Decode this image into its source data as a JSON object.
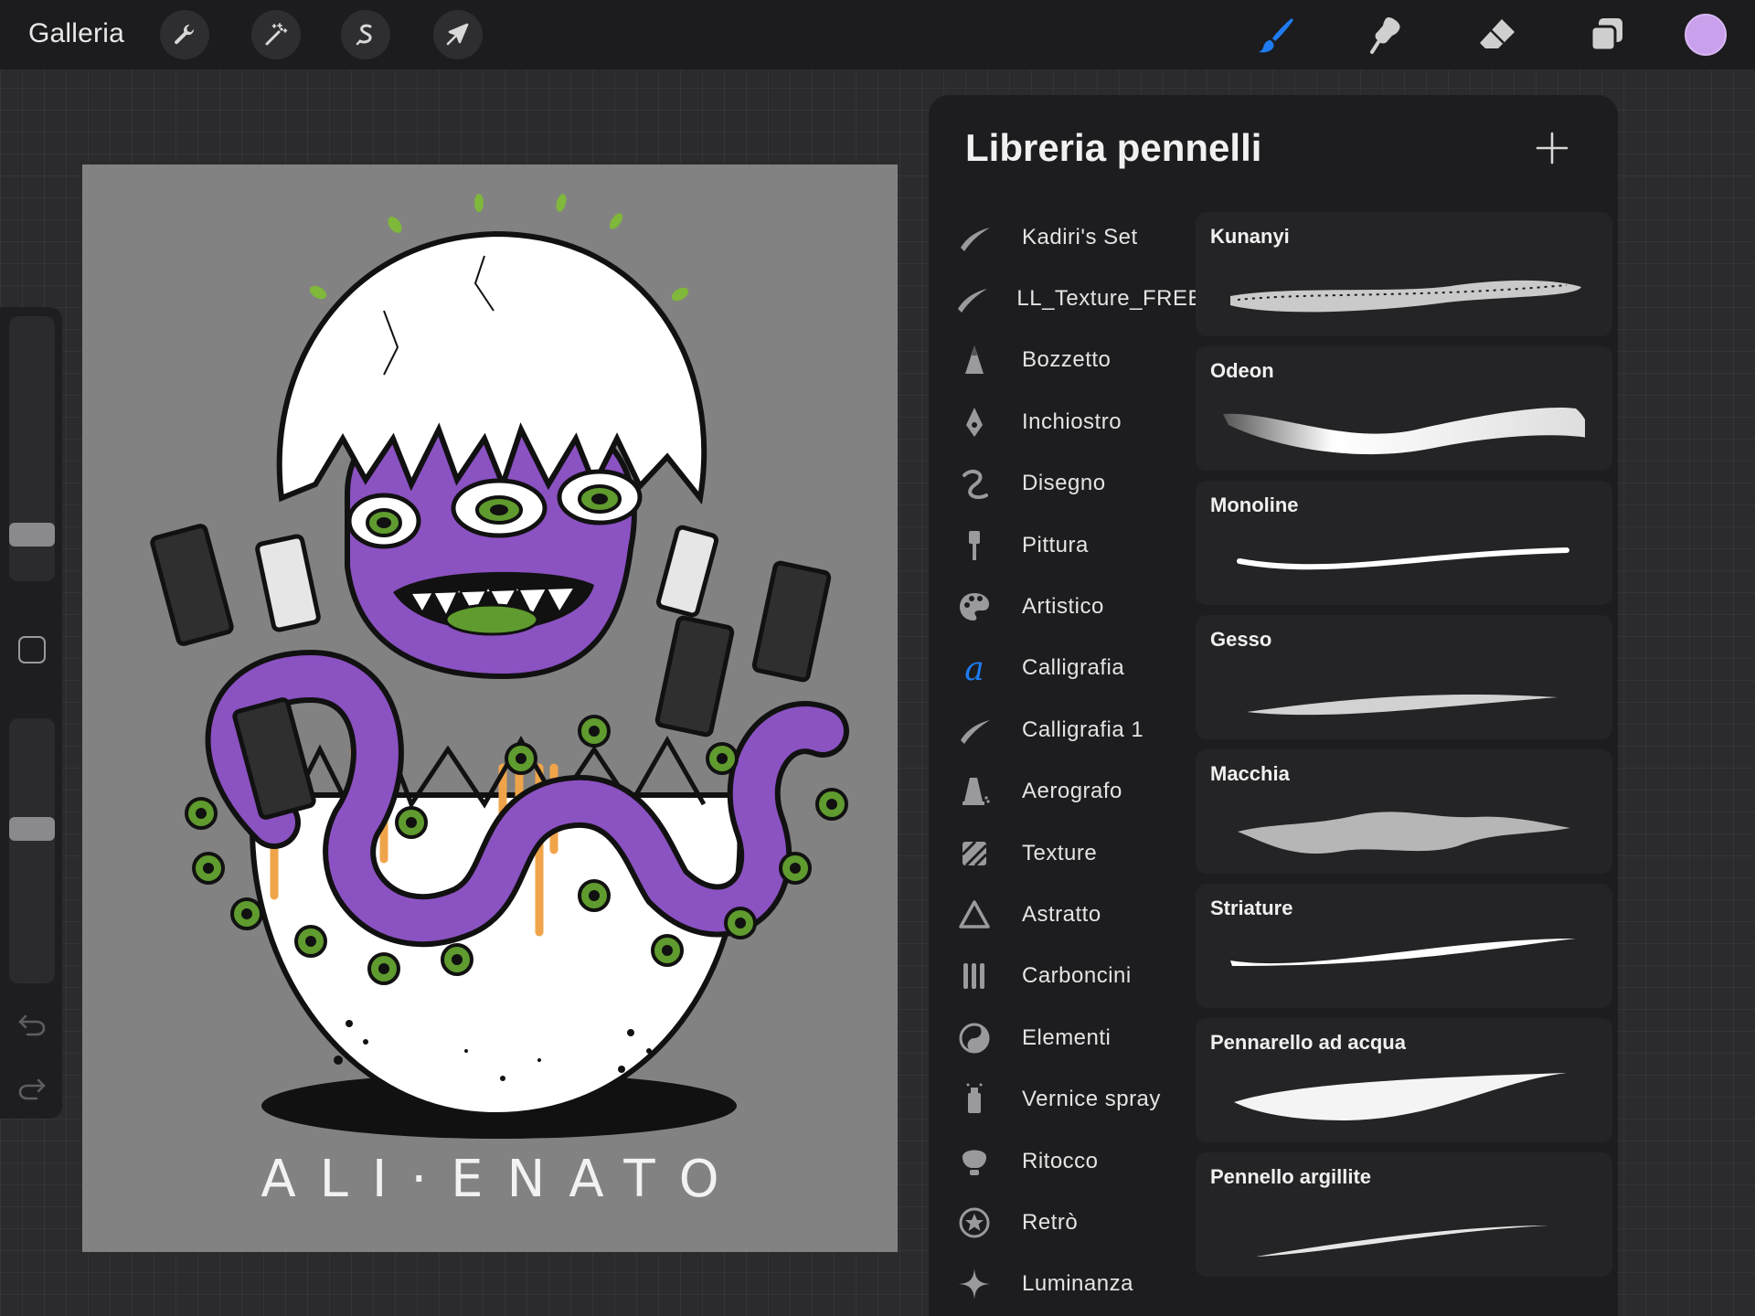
{
  "topbar": {
    "gallery_label": "Galleria",
    "left_tools": [
      {
        "name": "actions",
        "icon": "wrench-icon"
      },
      {
        "name": "adjustments",
        "icon": "magic-wand-icon"
      },
      {
        "name": "selection",
        "icon": "selection-s-icon"
      },
      {
        "name": "transform",
        "icon": "arrow-cursor-icon"
      }
    ],
    "right_tools": [
      {
        "name": "brush",
        "icon": "brush-icon",
        "active": true
      },
      {
        "name": "smudge",
        "icon": "smudge-icon"
      },
      {
        "name": "eraser",
        "icon": "eraser-icon"
      },
      {
        "name": "layers",
        "icon": "layers-icon"
      }
    ],
    "color": "#c9a0ec",
    "accent": "#1e7cf2"
  },
  "sidebar": {
    "size_slider_level": 0.25,
    "opacity_slider_level": 0.6
  },
  "artwork": {
    "caption": "ALIENATO",
    "background": "#828282",
    "colors": {
      "purple": "#8b52c2",
      "green": "#5f9b2e",
      "orange": "#f0a44a"
    }
  },
  "panel": {
    "title": "Libreria pennelli",
    "add_icon": "plus-icon",
    "sets": [
      {
        "label": "Kadiri's Set",
        "icon": "stroke-icon"
      },
      {
        "label": "LL_Texture_FREE",
        "icon": "stroke-icon"
      },
      {
        "label": "Bozzetto",
        "icon": "pencil-tip-icon"
      },
      {
        "label": "Inchiostro",
        "icon": "pen-nib-icon"
      },
      {
        "label": "Disegno",
        "icon": "squiggle-icon"
      },
      {
        "label": "Pittura",
        "icon": "paint-brush-icon"
      },
      {
        "label": "Artistico",
        "icon": "palette-icon"
      },
      {
        "label": "Calligrafia",
        "icon": "calligraphy-a-icon",
        "active": true
      },
      {
        "label": "Calligrafia 1",
        "icon": "stroke-icon"
      },
      {
        "label": "Aerografo",
        "icon": "airbrush-icon"
      },
      {
        "label": "Texture",
        "icon": "texture-icon"
      },
      {
        "label": "Astratto",
        "icon": "triangle-icon"
      },
      {
        "label": "Carboncini",
        "icon": "charcoal-icon"
      },
      {
        "label": "Elementi",
        "icon": "yin-yang-icon"
      },
      {
        "label": "Vernice spray",
        "icon": "spray-can-icon"
      },
      {
        "label": "Ritocco",
        "icon": "retouch-icon"
      },
      {
        "label": "Retrò",
        "icon": "star-circle-icon"
      },
      {
        "label": "Luminanza",
        "icon": "sparkle-icon"
      }
    ],
    "brushes": [
      {
        "name": "Kunanyi",
        "style": "textured"
      },
      {
        "name": "Odeon",
        "style": "soft-wide"
      },
      {
        "name": "Monoline",
        "style": "mono"
      },
      {
        "name": "Gesso",
        "style": "chalk"
      },
      {
        "name": "Macchia",
        "style": "blot"
      },
      {
        "name": "Striature",
        "style": "taper"
      },
      {
        "name": "Pennarello ad acqua",
        "style": "marker"
      },
      {
        "name": "Pennello argillite",
        "style": "clay"
      }
    ]
  }
}
